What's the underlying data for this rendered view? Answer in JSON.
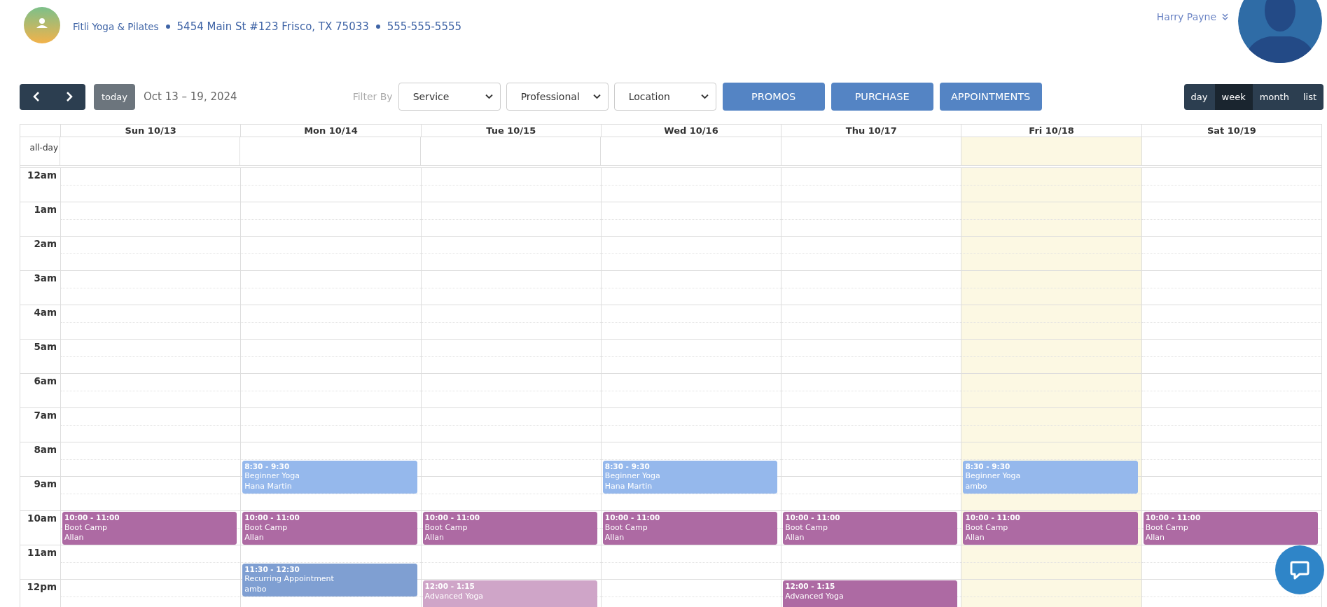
{
  "header": {
    "business_name": "Fitli Yoga & Pilates",
    "address": "5454 Main St #123 Frisco, TX 75033",
    "phone": "555-555-5555",
    "user_name": "Harry Payne"
  },
  "toolbar": {
    "today_label": "today",
    "date_range": "Oct 13 – 19, 2024",
    "filter_label": "Filter By",
    "filters": [
      {
        "label": "Service"
      },
      {
        "label": "Professional"
      },
      {
        "label": "Location"
      }
    ],
    "actions": [
      "PROMOS",
      "PURCHASE",
      "APPOINTMENTS"
    ],
    "views": [
      {
        "label": "day",
        "selected": false
      },
      {
        "label": "week",
        "selected": true
      },
      {
        "label": "month",
        "selected": false
      },
      {
        "label": "list",
        "selected": false
      }
    ]
  },
  "calendar": {
    "allday_label": "all-day",
    "hours": [
      "12am",
      "1am",
      "2am",
      "3am",
      "4am",
      "5am",
      "6am",
      "7am",
      "8am",
      "9am",
      "10am",
      "11am",
      "12pm"
    ],
    "days": [
      {
        "label": "Sun 10/13",
        "today": false,
        "events": [
          {
            "time": "10:00 - 11:00",
            "title": "Boot Camp",
            "person": "Allan",
            "color": "#ad6aa3"
          }
        ]
      },
      {
        "label": "Mon 10/14",
        "today": false,
        "events": [
          {
            "time": "8:30 - 9:30",
            "title": "Beginner Yoga",
            "person": "Hana Martin",
            "color": "#95b8ec"
          },
          {
            "time": "10:00 - 11:00",
            "title": "Boot Camp",
            "person": "Allan",
            "color": "#ad6aa3"
          },
          {
            "time": "11:30 - 12:30",
            "title": "Recurring Appointment",
            "person": "ambo",
            "color": "#7f9fd2"
          }
        ]
      },
      {
        "label": "Tue 10/15",
        "today": false,
        "events": [
          {
            "time": "10:00 - 11:00",
            "title": "Boot Camp",
            "person": "Allan",
            "color": "#ad6aa3"
          },
          {
            "time": "12:00 - 1:15",
            "title": "Advanced Yoga",
            "color": "#cfa5c8"
          }
        ]
      },
      {
        "label": "Wed 10/16",
        "today": false,
        "events": [
          {
            "time": "8:30 - 9:30",
            "title": "Beginner Yoga",
            "person": "Hana Martin",
            "color": "#95b8ec"
          },
          {
            "time": "10:00 - 11:00",
            "title": "Boot Camp",
            "person": "Allan",
            "color": "#ad6aa3"
          }
        ]
      },
      {
        "label": "Thu 10/17",
        "today": false,
        "events": [
          {
            "time": "10:00 - 11:00",
            "title": "Boot Camp",
            "person": "Allan",
            "color": "#ad6aa3"
          },
          {
            "time": "12:00 - 1:15",
            "title": "Advanced Yoga",
            "color": "#ad6aa3"
          }
        ]
      },
      {
        "label": "Fri 10/18",
        "today": true,
        "events": [
          {
            "time": "8:30 - 9:30",
            "title": "Beginner Yoga",
            "person": "ambo",
            "color": "#95b8ec"
          },
          {
            "time": "10:00 - 11:00",
            "title": "Boot Camp",
            "person": "Allan",
            "color": "#ad6aa3"
          }
        ]
      },
      {
        "label": "Sat 10/19",
        "today": false,
        "events": [
          {
            "time": "10:00 - 11:00",
            "title": "Boot Camp",
            "person": "Allan",
            "color": "#ad6aa3"
          }
        ]
      }
    ]
  }
}
